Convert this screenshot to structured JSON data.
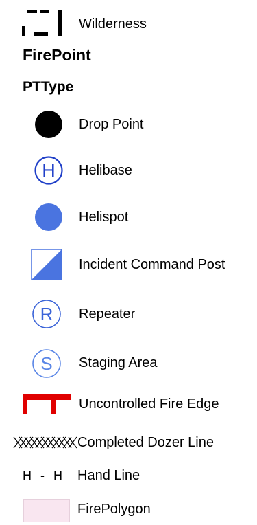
{
  "legend": {
    "layers": [
      {
        "title": "",
        "items": [
          {
            "label": "Wilderness",
            "icon": "dashed-boundary-icon"
          }
        ]
      },
      {
        "title": "FirePoint",
        "field": "PTType",
        "items": [
          {
            "label": "Drop Point",
            "icon": "black-filled-circle-icon",
            "color": "#000000"
          },
          {
            "label": "Helibase",
            "icon": "circled-h-icon",
            "color": "#1f3fc8"
          },
          {
            "label": "Helispot",
            "icon": "blue-filled-circle-icon",
            "color": "#4a74e0"
          },
          {
            "label": "Incident Command Post",
            "icon": "half-filled-square-icon",
            "color": "#4a74e0"
          },
          {
            "label": "Repeater",
            "icon": "circled-r-icon",
            "color": "#3b64d8"
          },
          {
            "label": "Staging Area",
            "icon": "circled-s-icon",
            "color": "#5a86e6"
          }
        ]
      },
      {
        "title": "",
        "items": [
          {
            "label": "Uncontrolled Fire Edge",
            "icon": "red-edge-line-icon",
            "color": "#e00000"
          },
          {
            "label": "Completed Dozer Line",
            "icon": "crosshatch-line-icon",
            "color": "#000000"
          },
          {
            "label": "Hand Line",
            "icon": "h-dash-h-line-icon",
            "color": "#000000",
            "glyph": "H - H"
          },
          {
            "label": "FirePolygon",
            "icon": "pink-polygon-swatch-icon",
            "color": "#f9e6f0"
          }
        ]
      }
    ],
    "icon_text": {
      "helibase": "H",
      "repeater": "R",
      "staging": "S"
    }
  }
}
